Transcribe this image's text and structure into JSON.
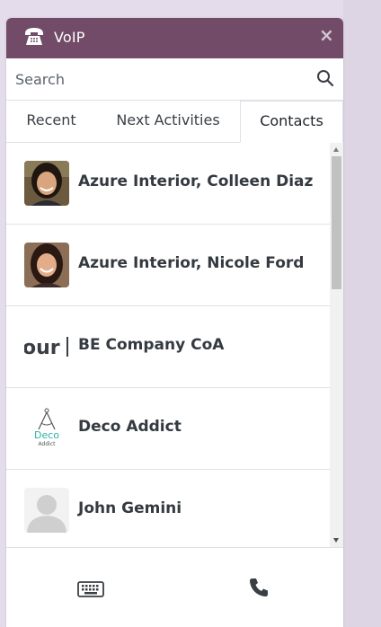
{
  "header": {
    "title": "VoIP",
    "background": "#714b67"
  },
  "search": {
    "placeholder": "Search",
    "value": ""
  },
  "tabs": [
    {
      "label": "Recent",
      "active": false
    },
    {
      "label": "Next Activities",
      "active": false
    },
    {
      "label": "Contacts",
      "active": true
    }
  ],
  "contacts": [
    {
      "name": "Azure Interior, Colleen Diaz",
      "avatar": "photo-woman-1"
    },
    {
      "name": "Azure Interior, Nicole Ford",
      "avatar": "photo-woman-2"
    },
    {
      "name": "BE Company CoA",
      "avatar": "company-logo-our"
    },
    {
      "name": "Deco Addict",
      "avatar": "deco-addict-logo",
      "logo_text": [
        "Deco",
        "Addict"
      ]
    },
    {
      "name": "John Gemini",
      "avatar": "placeholder-person"
    }
  ],
  "footer": {
    "keypad_icon": "keyboard-icon",
    "call_icon": "phone-call-icon"
  }
}
